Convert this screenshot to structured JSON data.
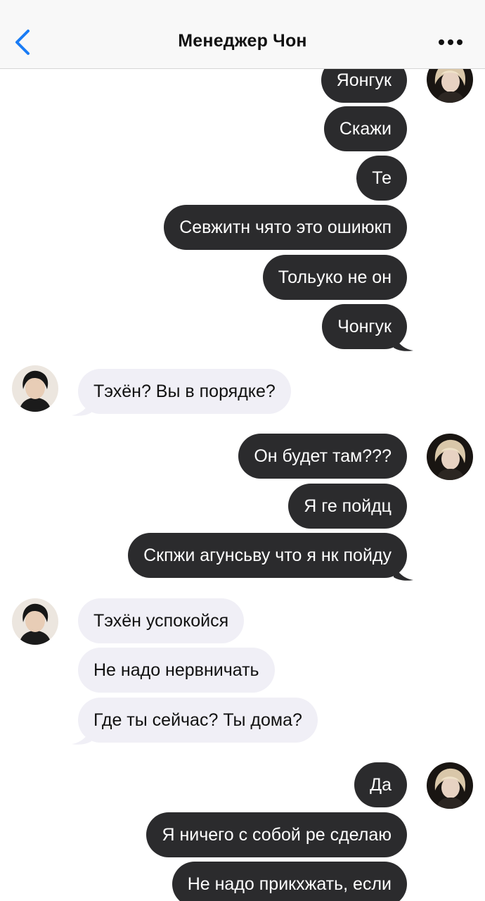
{
  "header": {
    "title": "Менеджер Чон",
    "back_icon": "chevron-left-icon",
    "more_icon": "ellipsis-icon",
    "accent_color": "#1a7cf5"
  },
  "colors": {
    "outgoing_bubble": "#2b2b2d",
    "incoming_bubble": "#f0eff6"
  },
  "messages": [
    {
      "sender": "me",
      "text": "Яонгук"
    },
    {
      "sender": "me",
      "text": "Скажи"
    },
    {
      "sender": "me",
      "text": "Те"
    },
    {
      "sender": "me",
      "text": "Севжитн чято это ошиюкп"
    },
    {
      "sender": "me",
      "text": "Тольуко не он"
    },
    {
      "sender": "me",
      "text": "Чонгук"
    },
    {
      "sender": "manager",
      "text": "Тэхён? Вы в порядке?"
    },
    {
      "sender": "me",
      "text": "Он будет там???"
    },
    {
      "sender": "me",
      "text": "Я ге пойдц"
    },
    {
      "sender": "me",
      "text": "Скпжи агунсьву что я нк пойду"
    },
    {
      "sender": "manager",
      "text": "Тэхён успокойся"
    },
    {
      "sender": "manager",
      "text": "Не надо нервничать"
    },
    {
      "sender": "manager",
      "text": "Где ты сейчас? Ты дома?"
    },
    {
      "sender": "me",
      "text": "Да"
    },
    {
      "sender": "me",
      "text": "Я ничего с собой ре сделаю"
    },
    {
      "sender": "me",
      "text": "Не надо прикхжать, если"
    }
  ]
}
